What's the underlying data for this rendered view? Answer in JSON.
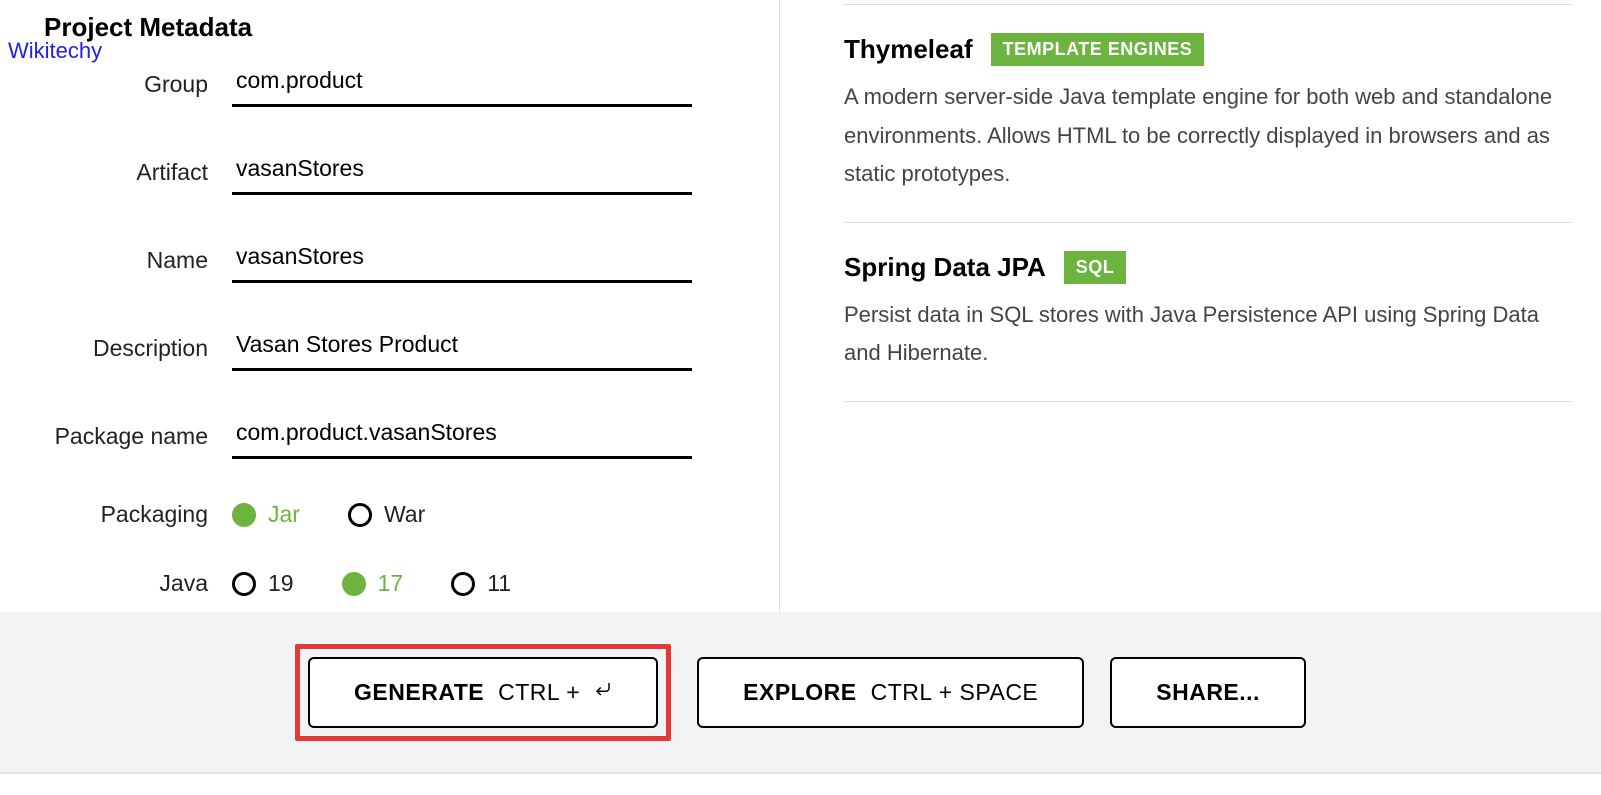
{
  "brand_link": "Wikitechy",
  "section_title": "Project Metadata",
  "form": {
    "group": {
      "label": "Group",
      "value": "com.product"
    },
    "artifact": {
      "label": "Artifact",
      "value": "vasanStores"
    },
    "name": {
      "label": "Name",
      "value": "vasanStores"
    },
    "description": {
      "label": "Description",
      "value": "Vasan Stores Product"
    },
    "package_name": {
      "label": "Package name",
      "value": "com.product.vasanStores"
    },
    "packaging": {
      "label": "Packaging",
      "options": [
        "Jar",
        "War"
      ],
      "selected": "Jar"
    },
    "java": {
      "label": "Java",
      "options": [
        "19",
        "17",
        "11"
      ],
      "selected": "17"
    }
  },
  "dependencies": [
    {
      "name": "Thymeleaf",
      "badge": "TEMPLATE ENGINES",
      "desc": "A modern server-side Java template engine for both web and standalone environments. Allows HTML to be correctly displayed in browsers and as static prototypes."
    },
    {
      "name": "Spring Data JPA",
      "badge": "SQL",
      "desc": "Persist data in SQL stores with Java Persistence API using Spring Data and Hibernate."
    }
  ],
  "footer": {
    "generate": {
      "label": "GENERATE",
      "shortcut": "CTRL +",
      "icon": "⏎"
    },
    "explore": {
      "label": "EXPLORE",
      "shortcut": "CTRL + SPACE"
    },
    "share": {
      "label": "SHARE..."
    }
  }
}
